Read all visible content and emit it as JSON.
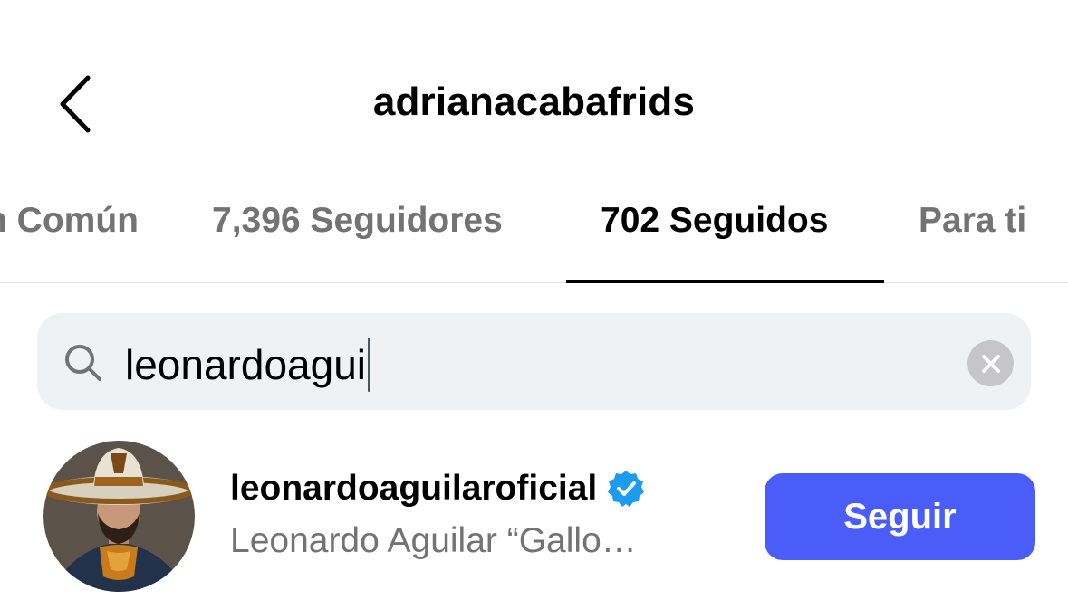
{
  "header": {
    "title": "adrianacabafrids",
    "back_icon": "chevron-left-icon"
  },
  "tabs": [
    {
      "label": "n Común",
      "active": false
    },
    {
      "label": "7,396 Seguidores",
      "active": false
    },
    {
      "label": "702 Seguidos",
      "active": true
    },
    {
      "label": "Para ti",
      "active": false
    }
  ],
  "search": {
    "value": "leonardoagui",
    "search_icon": "search-icon",
    "clear_icon": "clear-icon"
  },
  "results": [
    {
      "username": "leonardoaguilaroficial",
      "verified": true,
      "full_name": "Leonardo Aguilar “Gallo…",
      "button_label": "Seguir"
    }
  ],
  "colors": {
    "follow_button": "#4a5df9",
    "verified_badge": "#1d9bf0",
    "inactive_tab": "#737373",
    "search_bg": "#eff1f3"
  }
}
